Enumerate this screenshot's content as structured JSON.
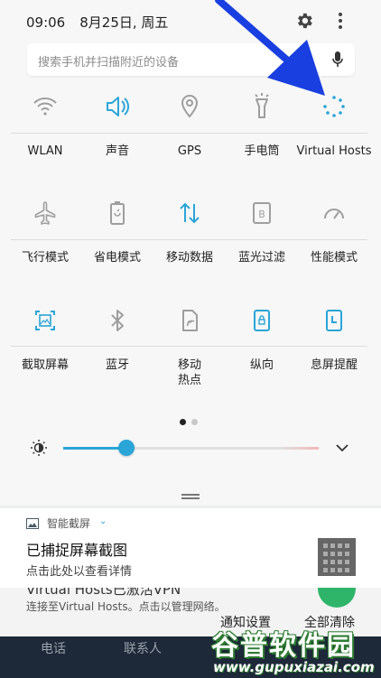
{
  "status": {
    "time": "09:06",
    "date": "8月25日, 周五"
  },
  "search": {
    "placeholder": "搜索手机并扫描附近的设备"
  },
  "quick_tiles": [
    {
      "label": "WLAN",
      "icon": "wifi-icon",
      "active": false
    },
    {
      "label": "声音",
      "icon": "sound-icon",
      "active": true
    },
    {
      "label": "GPS",
      "icon": "location-icon",
      "active": false
    },
    {
      "label": "手电筒",
      "icon": "flashlight-icon",
      "active": false
    },
    {
      "label": "Virtual Hosts",
      "icon": "loading-dots-icon",
      "active": true
    },
    {
      "label": "飞行模式",
      "icon": "airplane-icon",
      "active": false
    },
    {
      "label": "省电模式",
      "icon": "battery-saver-icon",
      "active": false
    },
    {
      "label": "移动数据",
      "icon": "mobile-data-icon",
      "active": true
    },
    {
      "label": "蓝光过滤",
      "icon": "blue-light-filter-icon",
      "active": false
    },
    {
      "label": "性能模式",
      "icon": "performance-gauge-icon",
      "active": false
    },
    {
      "label": "截取屏幕",
      "icon": "screenshot-icon",
      "active": true
    },
    {
      "label": "蓝牙",
      "icon": "bluetooth-icon",
      "active": false
    },
    {
      "label": "移动\n热点",
      "icon": "hotspot-icon",
      "active": false
    },
    {
      "label": "纵向",
      "icon": "portrait-lock-icon",
      "active": true
    },
    {
      "label": "息屏提醒",
      "icon": "always-on-display-icon",
      "active": true
    }
  ],
  "pager": {
    "pages": 2,
    "current": 1
  },
  "brightness": {
    "level": 0.2
  },
  "notification": {
    "app_name": "智能截屏",
    "title": "已捕捉屏幕截图",
    "body": "点击此处以查看详情"
  },
  "underlying_notification": {
    "title_partial": "Virtual Hosts已激活VPN",
    "body_partial": "连接至Virtual Hosts。点击以管理网络。"
  },
  "actions": {
    "settings": "通知设置",
    "clear_all": "全部清除"
  },
  "navbar": {
    "phone": "电话",
    "contacts": "联系人"
  },
  "watermark": {
    "logo": "谷普软件园",
    "url": "www.gupuxiazai.com"
  },
  "colors": {
    "accent": "#2aa5d8",
    "inactive": "#9e9e9e",
    "arrow": "#1a3fe0",
    "navbar": "#1d2838"
  }
}
